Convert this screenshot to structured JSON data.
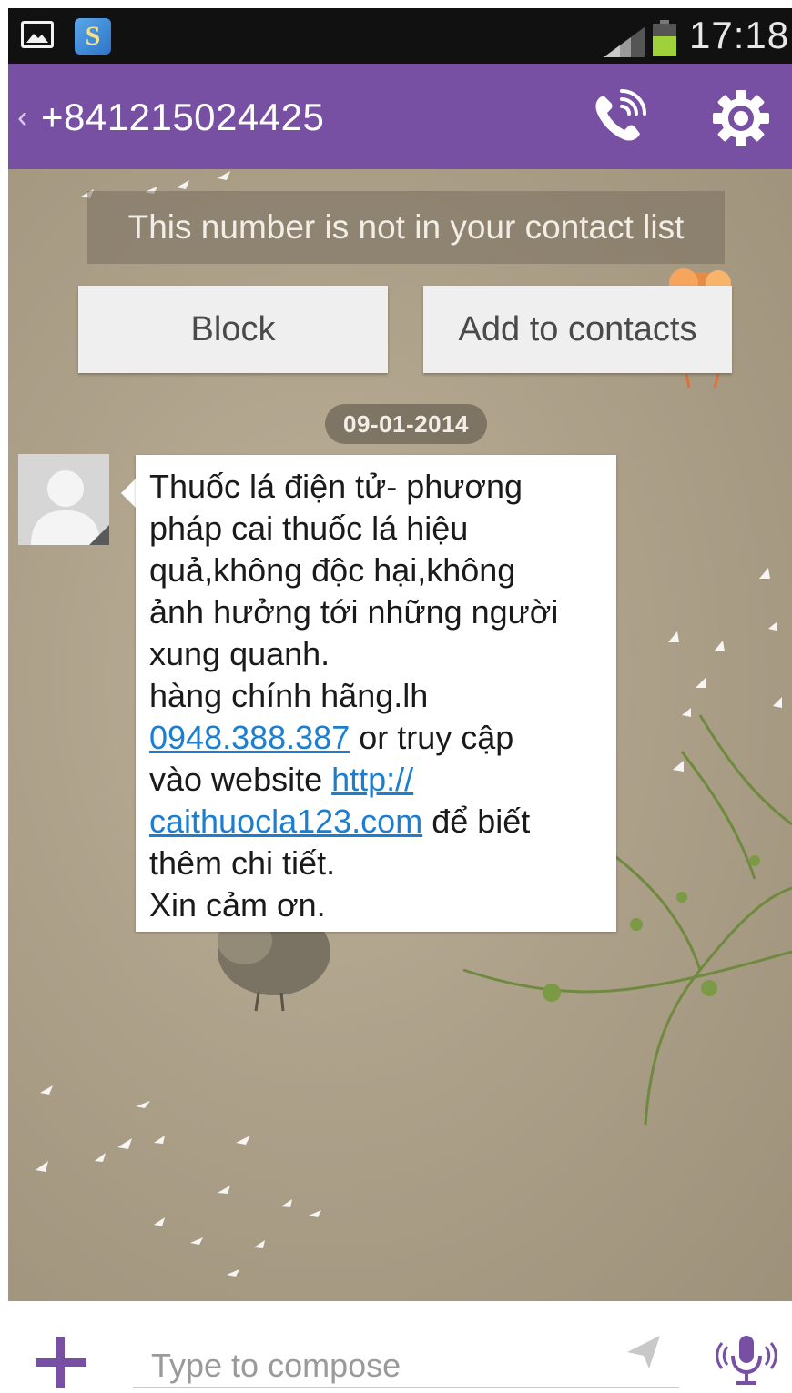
{
  "status_bar": {
    "time": "17:18",
    "icons": [
      "gallery-icon",
      "app-s-icon",
      "signal-icon",
      "battery-icon"
    ],
    "app_badge_letter": "S"
  },
  "header": {
    "title": "+841215024425",
    "back_icon": "chevron-left-icon",
    "actions": [
      "phone-call-icon",
      "gear-icon"
    ],
    "background_color": "#7750a4"
  },
  "notice": {
    "text": "This number is not in your contact list"
  },
  "actions": {
    "block_label": "Block",
    "add_contact_label": "Add to contacts"
  },
  "conversation": {
    "date": "09-01-2014",
    "message": {
      "line1": "Thuốc lá điện tử- phương",
      "line2": "pháp cai thuốc lá hiệu",
      "line3": "quả,không độc hại,không",
      "line4": "ảnh hưởng tới những người",
      "line5": "xung quanh.",
      "line6": "hàng chính hãng.lh",
      "phone_link": "0948.388.387",
      "line7_rest": " or truy cập",
      "line8_text": "vào website ",
      "url_part1": "http://",
      "url_part2": "caithuocla123.com",
      "line9_rest": " để biết",
      "line10": "thêm chi tiết.",
      "line11": "Xin cảm ơn."
    },
    "link_color": "#1b7ed1"
  },
  "compose": {
    "placeholder": "Type to compose",
    "icons": [
      "plus-icon",
      "send-icon",
      "microphone-icon"
    ]
  }
}
